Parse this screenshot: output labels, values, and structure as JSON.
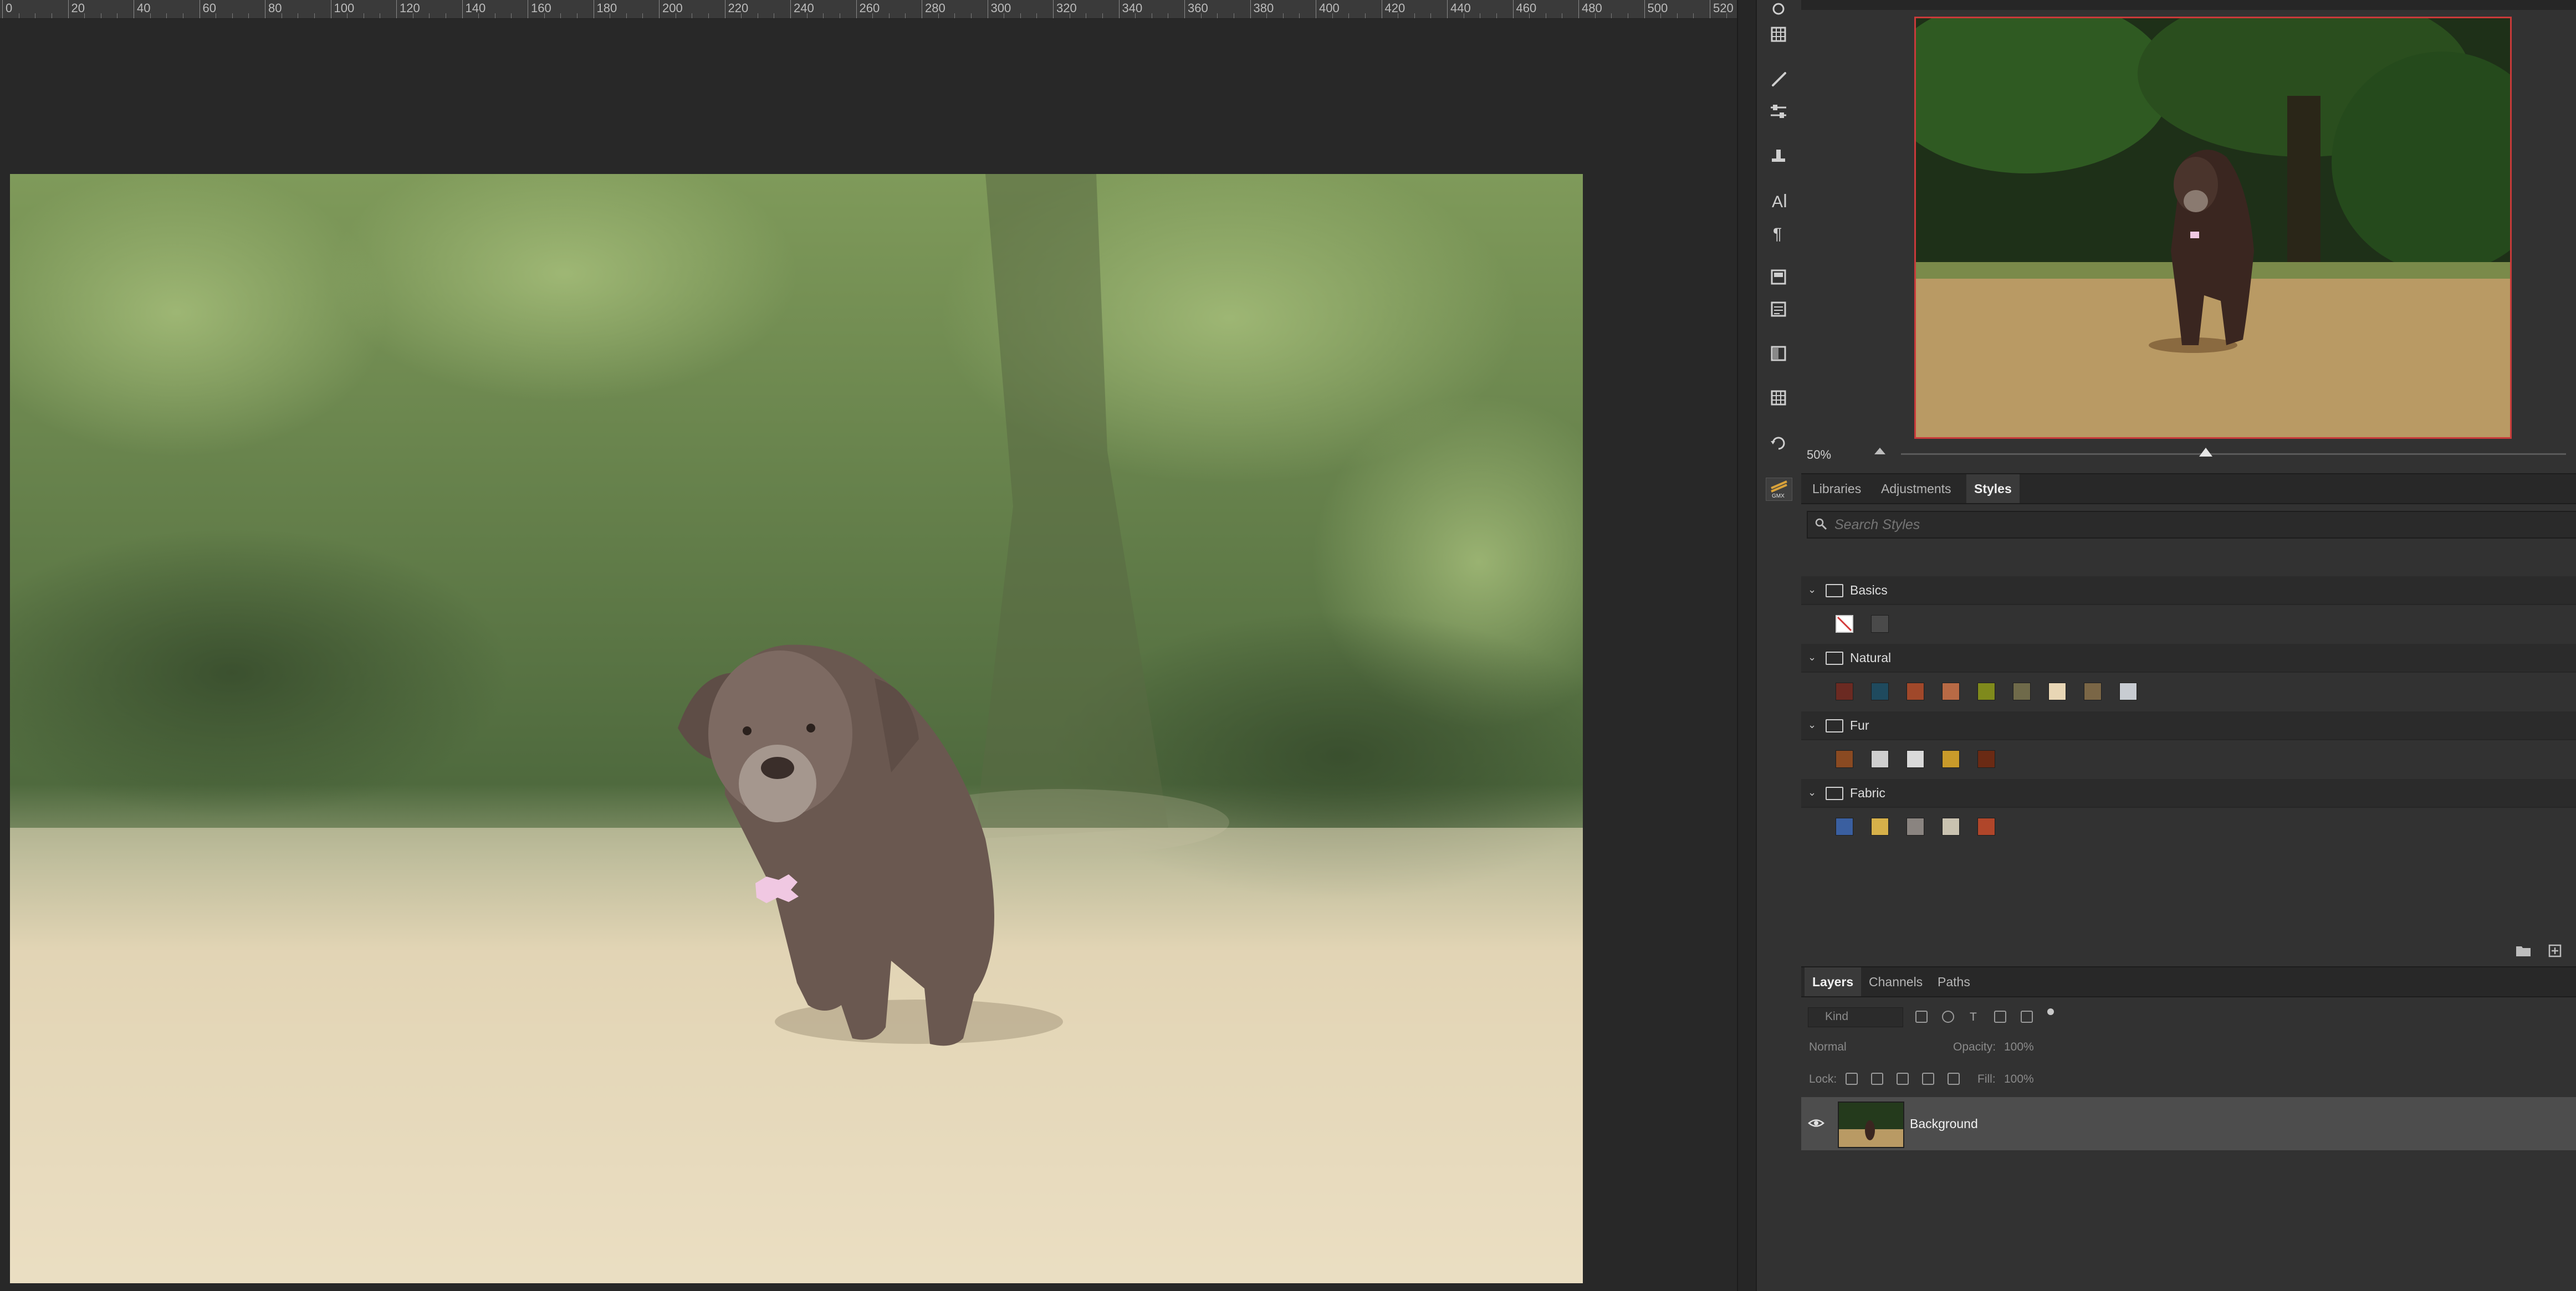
{
  "ruler": {
    "ticks": [
      "0",
      "20",
      "40",
      "60",
      "80",
      "100",
      "120",
      "140",
      "160",
      "180",
      "200",
      "220",
      "240",
      "260",
      "280",
      "300",
      "320",
      "340",
      "360",
      "380",
      "400",
      "420",
      "440",
      "460",
      "480",
      "500",
      "520"
    ]
  },
  "navigator": {
    "zoom": "50%"
  },
  "styles_panel": {
    "tabs": [
      "Libraries",
      "Adjustments",
      "Styles"
    ],
    "active_tab": "Styles",
    "search_placeholder": "Search Styles",
    "groups": [
      {
        "name": "Basics",
        "swatches": [
          "#ffffff",
          "#4a4a4a"
        ]
      },
      {
        "name": "Natural",
        "swatches": [
          "#6b2a22",
          "#1f4a5e",
          "#a0482a",
          "#b86a45",
          "#7f8a1c",
          "#6f6a4a",
          "#e8d6b5",
          "#7a6646",
          "#c8ccd2"
        ]
      },
      {
        "name": "Fur",
        "swatches": [
          "#8a4a22",
          "#cfcfcf",
          "#d9d9d9",
          "#c99a2a",
          "#6a2a14"
        ]
      },
      {
        "name": "Fabric",
        "swatches": [
          "#3a5fa0",
          "#d6b04a",
          "#8a8480",
          "#c9c2b0",
          "#b0462a"
        ]
      }
    ]
  },
  "layers_panel": {
    "tabs": [
      "Layers",
      "Channels",
      "Paths"
    ],
    "active_tab": "Layers",
    "filter_placeholder": "Kind",
    "blend_mode": "Normal",
    "opacity_label": "Opacity:",
    "opacity_value": "100%",
    "lock_label": "Lock:",
    "fill_label": "Fill:",
    "fill_value": "100%",
    "layers": [
      {
        "name": "Background",
        "visible": true
      }
    ]
  },
  "tool_strip": {
    "icons": [
      "libraries-icon",
      "table-icon",
      "brush-icon",
      "sliders-icon",
      "stamp-icon",
      "character-icon",
      "paragraph-icon",
      "glyphs-icon",
      "notes-icon",
      "gradient-icon",
      "grid-icon",
      "history-icon",
      "gmx-plugin-icon"
    ]
  }
}
